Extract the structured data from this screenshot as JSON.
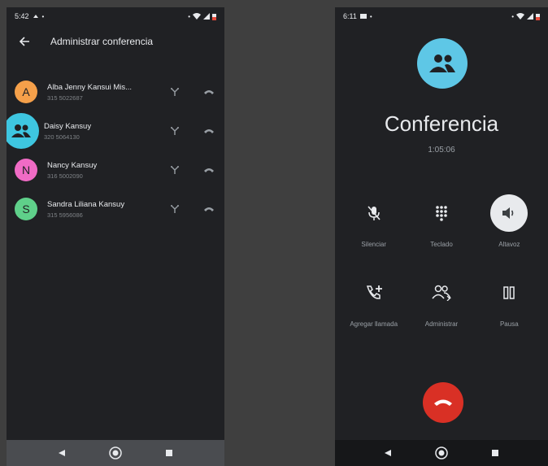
{
  "left_screen": {
    "status": {
      "time": "5:42"
    },
    "appbar": {
      "title": "Administrar conferencia"
    },
    "participants": [
      {
        "initial": "A",
        "name": "Alba Jenny Kansui Mis...",
        "phone": "315 5022687",
        "color": "#f5a04a"
      },
      {
        "initial": "",
        "name": "Daisy Kansuy",
        "phone": "320 5064130",
        "color": "#3ec6e0"
      },
      {
        "initial": "N",
        "name": "Nancy Kansuy",
        "phone": "316 5002090",
        "color": "#f06bc5"
      },
      {
        "initial": "S",
        "name": "Sandra Liliana Kansuy",
        "phone": "315 5956086",
        "color": "#5fd08a"
      }
    ]
  },
  "right_screen": {
    "status": {
      "time": "6:11"
    },
    "title": "Conferencia",
    "timer": "1:05:06",
    "controls": [
      {
        "label": "Silenciar",
        "icon": "mic-off-icon"
      },
      {
        "label": "Teclado",
        "icon": "dialpad-icon"
      },
      {
        "label": "Altavoz",
        "icon": "speaker-icon",
        "active": true
      },
      {
        "label": "Agregar llamada",
        "icon": "add-call-icon"
      },
      {
        "label": "Administrar",
        "icon": "manage-people-icon"
      },
      {
        "label": "Pausa",
        "icon": "pause-icon"
      }
    ]
  },
  "colors": {
    "background": "#202124",
    "end_call": "#d93025",
    "conference_avatar": "#5ec7e6"
  }
}
